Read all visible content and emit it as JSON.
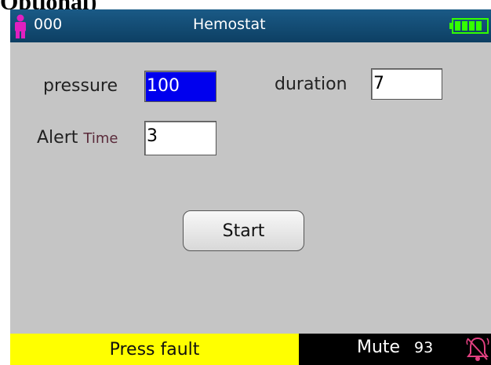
{
  "caption": "Optional)",
  "titlebar": {
    "patient_id": "000",
    "title": "Hemostat",
    "battery_color": "#33ff00"
  },
  "form": {
    "pressure_label": "pressure",
    "pressure_value": "100",
    "duration_label": "duration",
    "duration_value": "7",
    "alert_label_a": "Alert",
    "alert_label_b": "Time",
    "alert_value": "3",
    "selected_color": "#0000ee"
  },
  "buttons": {
    "start_label": "Start"
  },
  "statusbar": {
    "alarm_text": "Press fault",
    "alarm_color": "#ffff00",
    "mute_label": "Mute",
    "mute_value": "93"
  },
  "icons": {
    "patient": "person-icon",
    "battery": "battery-icon",
    "alarm": "alarm-bell-icon"
  }
}
